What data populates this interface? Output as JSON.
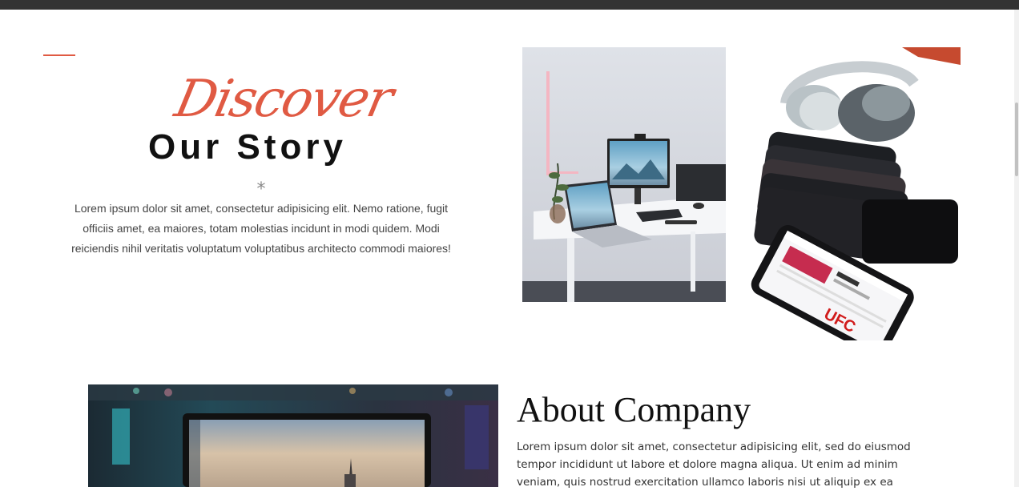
{
  "story": {
    "script_word": "Discover",
    "title": "Our Story",
    "ornament": "*",
    "paragraph": "Lorem ipsum dolor sit amet, consectetur adipisicing elit. Nemo ratione, fugit officiis amet, ea maiores, totam molestias incidunt in modi quidem. Modi reiciendis nihil veritatis voluptatum voluptatibus architecto commodi maiores!"
  },
  "about": {
    "title": "About Company",
    "paragraph": "Lorem ipsum dolor sit amet, consectetur adipisicing elit, sed do eiusmod tempor incididunt ut labore et dolore magna aliqua. Ut enim ad minim veniam, quis nostrud exercitation ullamco laboris nisi ut aliquip ex ea"
  },
  "phone_logo": "UFC",
  "colors": {
    "accent": "#e05a43",
    "heading": "#111111",
    "body_text": "#444444",
    "top_bar": "#333333"
  }
}
